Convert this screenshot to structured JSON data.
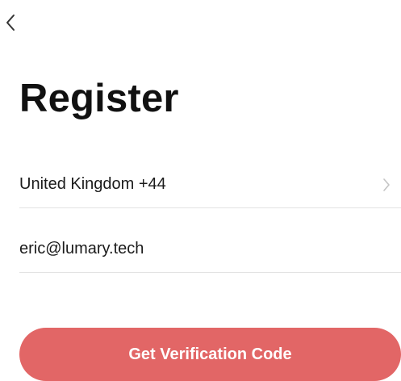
{
  "header": {
    "back_icon": "chevron-left-icon",
    "title": "Register"
  },
  "form": {
    "country": {
      "value": "United Kingdom +44",
      "icon": "chevron-right-icon"
    },
    "email": {
      "value": "eric@lumary.tech"
    }
  },
  "actions": {
    "get_code_label": "Get Verification Code"
  },
  "colors": {
    "primary_button": "#e26666",
    "divider": "#e3e3e3",
    "text": "#111111",
    "chevron_muted": "#c4c4c4"
  }
}
